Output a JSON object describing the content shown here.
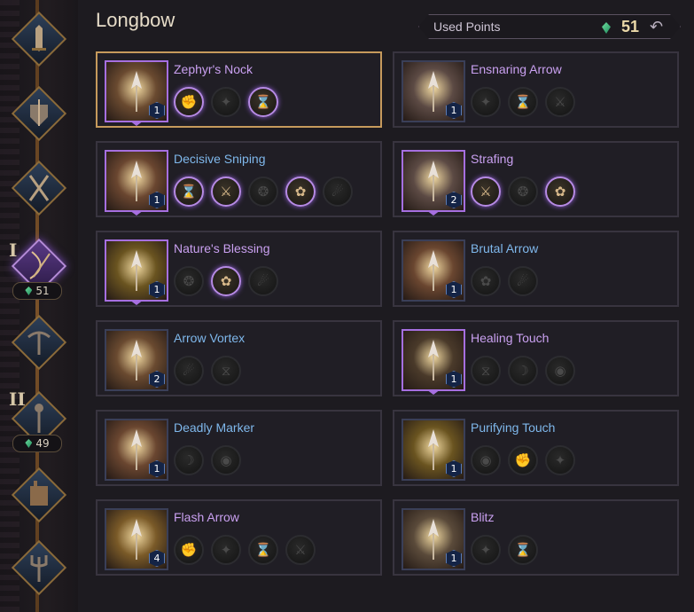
{
  "title": "Longbow",
  "used_points": {
    "label": "Used Points",
    "value": "51",
    "undo_icon": "undo-icon"
  },
  "rail": {
    "sections": [
      {
        "roman": "I",
        "points": "51"
      },
      {
        "roman": "II",
        "points": "49"
      }
    ],
    "weapons": [
      "sword-icon",
      "shield-icon",
      "dual-blades-icon",
      "longbow-icon",
      "crossbow-icon",
      "staff-icon",
      "fortress-icon",
      "trident-icon"
    ]
  },
  "skills": [
    {
      "name": "Zephyr's Nock",
      "color": "purple",
      "level": "1",
      "owned": true,
      "selected": true,
      "mods": [
        true,
        false,
        true
      ],
      "art": "#6a4a30"
    },
    {
      "name": "Ensnaring Arrow",
      "color": "purple",
      "level": "1",
      "owned": false,
      "selected": false,
      "mods": [
        false,
        false,
        false
      ],
      "art": "#5c4a44"
    },
    {
      "name": "Decisive Sniping",
      "color": "blue",
      "level": "1",
      "owned": true,
      "selected": false,
      "mods": [
        true,
        true,
        false,
        true,
        false
      ],
      "art": "#6a4630"
    },
    {
      "name": "Strafing",
      "color": "purple",
      "level": "2",
      "owned": true,
      "selected": false,
      "mods": [
        true,
        false,
        true
      ],
      "art": "#5c4a44"
    },
    {
      "name": "Nature's Blessing",
      "color": "purple",
      "level": "1",
      "owned": true,
      "selected": false,
      "mods": [
        false,
        true,
        false
      ],
      "art": "#6a5420"
    },
    {
      "name": "Brutal Arrow",
      "color": "blue",
      "level": "1",
      "owned": false,
      "selected": false,
      "mods": [
        false,
        false
      ],
      "art": "#6a4630"
    },
    {
      "name": "Arrow Vortex",
      "color": "blue",
      "level": "2",
      "owned": false,
      "selected": false,
      "mods": [
        false,
        false
      ],
      "art": "#6a4a30"
    },
    {
      "name": "Healing Touch",
      "color": "purple",
      "level": "1",
      "owned": true,
      "selected": false,
      "mods": [
        false,
        false,
        false
      ],
      "art": "#4a3a2a"
    },
    {
      "name": "Deadly Marker",
      "color": "blue",
      "level": "1",
      "owned": false,
      "selected": false,
      "mods": [
        false,
        false
      ],
      "art": "#6a4630"
    },
    {
      "name": "Purifying Touch",
      "color": "blue",
      "level": "1",
      "owned": false,
      "selected": false,
      "mods": [
        false,
        false,
        false
      ],
      "art": "#6a5420"
    },
    {
      "name": "Flash Arrow",
      "color": "purple",
      "level": "4",
      "owned": false,
      "selected": false,
      "mods": [
        false,
        false,
        false,
        false
      ],
      "art": "#7a5a28"
    },
    {
      "name": "Blitz",
      "color": "purple",
      "level": "1",
      "owned": false,
      "selected": false,
      "mods": [
        false,
        false
      ],
      "art": "#5a4a3a"
    }
  ]
}
